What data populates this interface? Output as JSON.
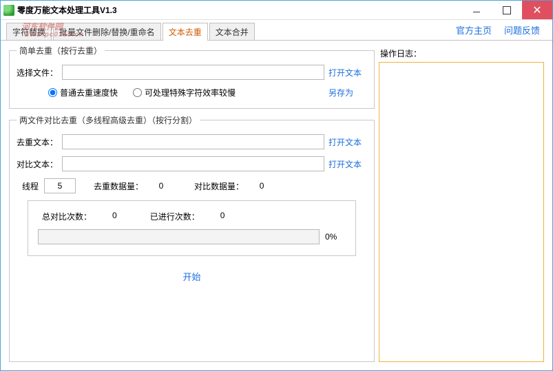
{
  "window": {
    "title": "零度万能文本处理工具V1.3"
  },
  "watermark": {
    "text": "河东软件园",
    "url": "www.pc0359.cn"
  },
  "tabs": {
    "items": [
      {
        "label": "字符替换"
      },
      {
        "label": "批量文件删除/替换/重命名"
      },
      {
        "label": "文本去重"
      },
      {
        "label": "文本合并"
      }
    ]
  },
  "header_links": {
    "home": "官方主页",
    "feedback": "问题反馈"
  },
  "group1": {
    "legend": "简单去重（按行去重）",
    "file_label": "选择文件：",
    "open_text": "打开文本",
    "save_as": "另存为",
    "radio_fast": "普通去重速度快",
    "radio_slow": "可处理特殊字符效率较慢"
  },
  "group2": {
    "legend": "两文件对比去重（多线程高级去重）（按行分割）",
    "dedup_label": "去重文本：",
    "compare_label": "对比文本：",
    "open_text": "打开文本",
    "thread_label": "线程",
    "thread_value": "5",
    "dedup_count_label": "去重数据量：",
    "dedup_count_value": "0",
    "compare_count_label": "对比数据量：",
    "compare_count_value": "0",
    "total_compare_label": "总对比次数：",
    "total_compare_value": "0",
    "done_label": "已进行次数：",
    "done_value": "0",
    "percent": "0%",
    "start": "开始"
  },
  "log": {
    "label": "操作日志："
  }
}
